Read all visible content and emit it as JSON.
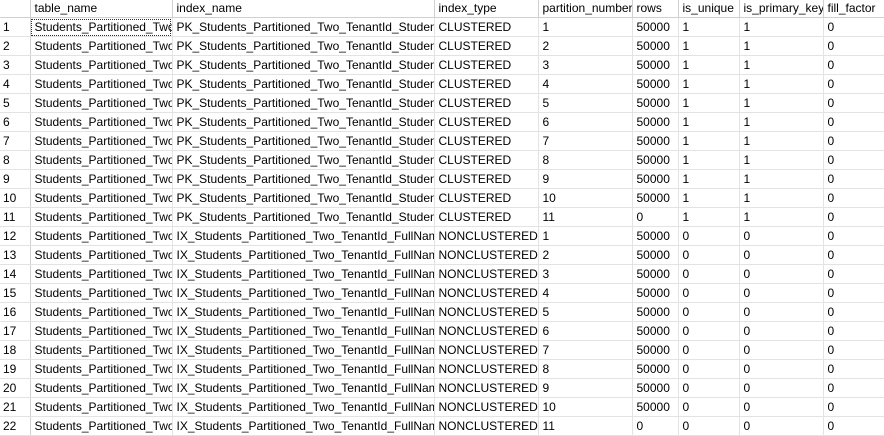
{
  "grid": {
    "columns": [
      "table_name",
      "index_name",
      "index_type",
      "partition_number",
      "rows",
      "is_unique",
      "is_primary_key",
      "fill_factor"
    ],
    "rows": [
      {
        "n": "1",
        "cells": [
          "Students_Partitioned_Two",
          "PK_Students_Partitioned_Two_TenantId_StudentId",
          "CLUSTERED",
          "1",
          "50000",
          "1",
          "1",
          "0"
        ]
      },
      {
        "n": "2",
        "cells": [
          "Students_Partitioned_Two",
          "PK_Students_Partitioned_Two_TenantId_StudentId",
          "CLUSTERED",
          "2",
          "50000",
          "1",
          "1",
          "0"
        ]
      },
      {
        "n": "3",
        "cells": [
          "Students_Partitioned_Two",
          "PK_Students_Partitioned_Two_TenantId_StudentId",
          "CLUSTERED",
          "3",
          "50000",
          "1",
          "1",
          "0"
        ]
      },
      {
        "n": "4",
        "cells": [
          "Students_Partitioned_Two",
          "PK_Students_Partitioned_Two_TenantId_StudentId",
          "CLUSTERED",
          "4",
          "50000",
          "1",
          "1",
          "0"
        ]
      },
      {
        "n": "5",
        "cells": [
          "Students_Partitioned_Two",
          "PK_Students_Partitioned_Two_TenantId_StudentId",
          "CLUSTERED",
          "5",
          "50000",
          "1",
          "1",
          "0"
        ]
      },
      {
        "n": "6",
        "cells": [
          "Students_Partitioned_Two",
          "PK_Students_Partitioned_Two_TenantId_StudentId",
          "CLUSTERED",
          "6",
          "50000",
          "1",
          "1",
          "0"
        ]
      },
      {
        "n": "7",
        "cells": [
          "Students_Partitioned_Two",
          "PK_Students_Partitioned_Two_TenantId_StudentId",
          "CLUSTERED",
          "7",
          "50000",
          "1",
          "1",
          "0"
        ]
      },
      {
        "n": "8",
        "cells": [
          "Students_Partitioned_Two",
          "PK_Students_Partitioned_Two_TenantId_StudentId",
          "CLUSTERED",
          "8",
          "50000",
          "1",
          "1",
          "0"
        ]
      },
      {
        "n": "9",
        "cells": [
          "Students_Partitioned_Two",
          "PK_Students_Partitioned_Two_TenantId_StudentId",
          "CLUSTERED",
          "9",
          "50000",
          "1",
          "1",
          "0"
        ]
      },
      {
        "n": "10",
        "cells": [
          "Students_Partitioned_Two",
          "PK_Students_Partitioned_Two_TenantId_StudentId",
          "CLUSTERED",
          "10",
          "50000",
          "1",
          "1",
          "0"
        ]
      },
      {
        "n": "11",
        "cells": [
          "Students_Partitioned_Two",
          "PK_Students_Partitioned_Two_TenantId_StudentId",
          "CLUSTERED",
          "11",
          "0",
          "1",
          "1",
          "0"
        ]
      },
      {
        "n": "12",
        "cells": [
          "Students_Partitioned_Two",
          "IX_Students_Partitioned_Two_TenantId_FullName",
          "NONCLUSTERED",
          "1",
          "50000",
          "0",
          "0",
          "0"
        ]
      },
      {
        "n": "13",
        "cells": [
          "Students_Partitioned_Two",
          "IX_Students_Partitioned_Two_TenantId_FullName",
          "NONCLUSTERED",
          "2",
          "50000",
          "0",
          "0",
          "0"
        ]
      },
      {
        "n": "14",
        "cells": [
          "Students_Partitioned_Two",
          "IX_Students_Partitioned_Two_TenantId_FullName",
          "NONCLUSTERED",
          "3",
          "50000",
          "0",
          "0",
          "0"
        ]
      },
      {
        "n": "15",
        "cells": [
          "Students_Partitioned_Two",
          "IX_Students_Partitioned_Two_TenantId_FullName",
          "NONCLUSTERED",
          "4",
          "50000",
          "0",
          "0",
          "0"
        ]
      },
      {
        "n": "16",
        "cells": [
          "Students_Partitioned_Two",
          "IX_Students_Partitioned_Two_TenantId_FullName",
          "NONCLUSTERED",
          "5",
          "50000",
          "0",
          "0",
          "0"
        ]
      },
      {
        "n": "17",
        "cells": [
          "Students_Partitioned_Two",
          "IX_Students_Partitioned_Two_TenantId_FullName",
          "NONCLUSTERED",
          "6",
          "50000",
          "0",
          "0",
          "0"
        ]
      },
      {
        "n": "18",
        "cells": [
          "Students_Partitioned_Two",
          "IX_Students_Partitioned_Two_TenantId_FullName",
          "NONCLUSTERED",
          "7",
          "50000",
          "0",
          "0",
          "0"
        ]
      },
      {
        "n": "19",
        "cells": [
          "Students_Partitioned_Two",
          "IX_Students_Partitioned_Two_TenantId_FullName",
          "NONCLUSTERED",
          "8",
          "50000",
          "0",
          "0",
          "0"
        ]
      },
      {
        "n": "20",
        "cells": [
          "Students_Partitioned_Two",
          "IX_Students_Partitioned_Two_TenantId_FullName",
          "NONCLUSTERED",
          "9",
          "50000",
          "0",
          "0",
          "0"
        ]
      },
      {
        "n": "21",
        "cells": [
          "Students_Partitioned_Two",
          "IX_Students_Partitioned_Two_TenantId_FullName",
          "NONCLUSTERED",
          "10",
          "50000",
          "0",
          "0",
          "0"
        ]
      },
      {
        "n": "22",
        "cells": [
          "Students_Partitioned_Two",
          "IX_Students_Partitioned_Two_TenantId_FullName",
          "NONCLUSTERED",
          "11",
          "0",
          "0",
          "0",
          "0"
        ]
      }
    ]
  }
}
